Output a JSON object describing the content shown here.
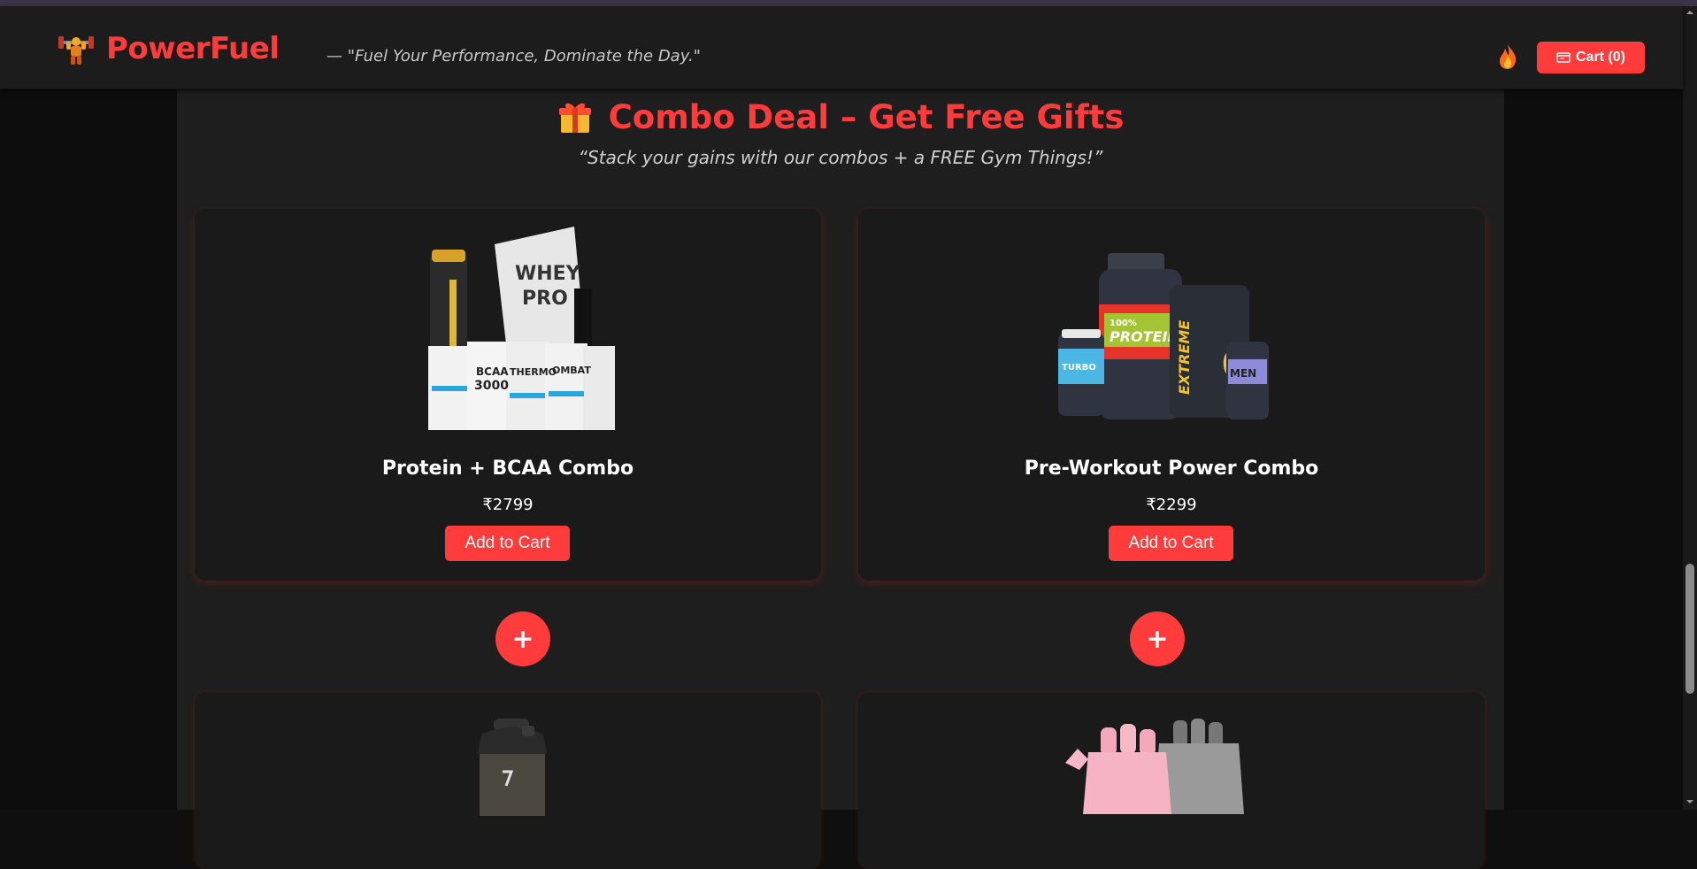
{
  "header": {
    "brand": "PowerFuel",
    "tagline": "— \"Fuel Your Performance, Dominate the Day.\"",
    "cart_label": "Cart (0)"
  },
  "section": {
    "title": "Combo Deal – Get Free Gifts",
    "subtitle": "“Stack your gains with our combos + a FREE Gym Things!”"
  },
  "products": [
    {
      "name": "Protein + BCAA Combo",
      "price": "₹2799",
      "button": "Add to Cart"
    },
    {
      "name": "Pre-Workout Power Combo",
      "price": "₹2299",
      "button": "Add to Cart"
    }
  ],
  "plus_label": "+",
  "gifts": [
    {
      "icon": "shaker-bottle-icon"
    },
    {
      "icon": "gym-gloves-icon"
    }
  ],
  "colors": {
    "accent": "#ff3b3b",
    "page_bg": "#1e1e1e",
    "card_bg": "#1a1a1a",
    "header_bg": "#1c1c1c"
  }
}
